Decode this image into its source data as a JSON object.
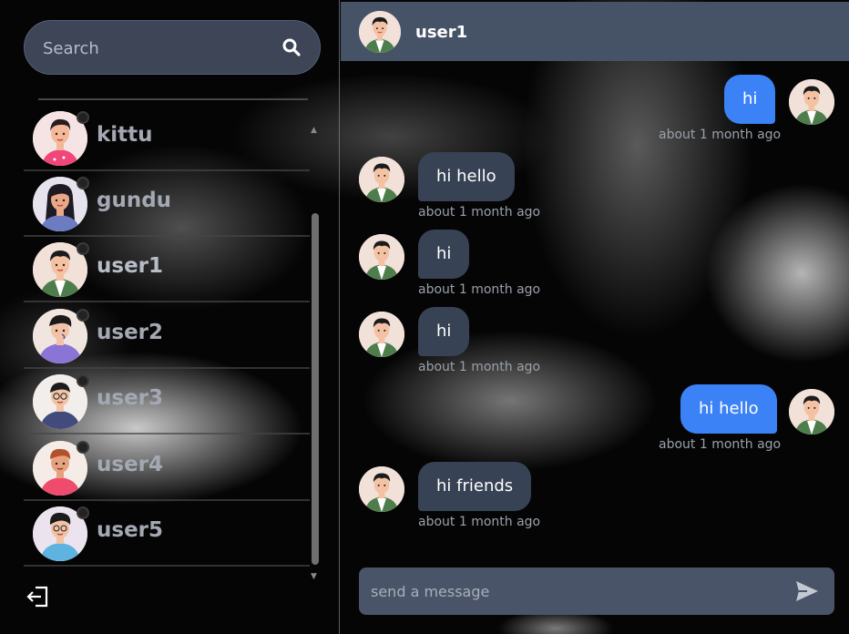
{
  "search": {
    "placeholder": "Search"
  },
  "contacts": [
    {
      "name": "kittu",
      "avatar": "girl-pink-avatar"
    },
    {
      "name": "gundu",
      "avatar": "girl-longhair-avatar"
    },
    {
      "name": "user1",
      "avatar": "boy-green-avatar"
    },
    {
      "name": "user2",
      "avatar": "boy-hoodie-avatar"
    },
    {
      "name": "user3",
      "avatar": "boy-glasses-avatar"
    },
    {
      "name": "user4",
      "avatar": "boy-redhair-avatar"
    },
    {
      "name": "user5",
      "avatar": "boy-blue-avatar"
    }
  ],
  "chat": {
    "header_name": "user1",
    "messages": [
      {
        "text": "hi",
        "time": "about 1 month ago",
        "direction": "out"
      },
      {
        "text": "hi hello",
        "time": "about 1 month ago",
        "direction": "in"
      },
      {
        "text": "hi",
        "time": "about 1 month ago",
        "direction": "in"
      },
      {
        "text": "hi",
        "time": "about 1 month ago",
        "direction": "in"
      },
      {
        "text": "hi hello",
        "time": "about 1 month ago",
        "direction": "out"
      },
      {
        "text": "hi friends",
        "time": "about 1 month ago",
        "direction": "in"
      }
    ]
  },
  "composer": {
    "placeholder": "send a message"
  },
  "colors": {
    "outgoing_bubble": "#3b82f6",
    "incoming_bubble": "#374254",
    "header_bg": "#465266",
    "search_bg": "#3d4557"
  },
  "icons": {
    "search": "search-icon",
    "send": "send-icon",
    "logout": "logout-icon",
    "scroll_up": "▲",
    "scroll_down": "▼"
  }
}
